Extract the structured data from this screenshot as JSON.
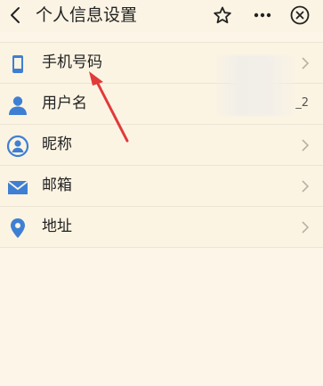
{
  "header": {
    "title": "个人信息设置",
    "icons": {
      "back": "back-arrow-icon",
      "star": "star-icon",
      "more": "more-icon",
      "close": "close-circle-icon"
    }
  },
  "settings": {
    "items": [
      {
        "label": "手机号码",
        "icon": "phone-icon",
        "value": ""
      },
      {
        "label": "用户名",
        "icon": "user-icon",
        "value": "_2"
      },
      {
        "label": "昵称",
        "icon": "nickname-icon",
        "value": ""
      },
      {
        "label": "邮箱",
        "icon": "mail-icon",
        "value": ""
      },
      {
        "label": "地址",
        "icon": "location-icon",
        "value": ""
      }
    ]
  },
  "colors": {
    "accent_blue": "#3f7fd3",
    "annotation_red": "#e03a3a",
    "background": "#fdf6e8"
  }
}
